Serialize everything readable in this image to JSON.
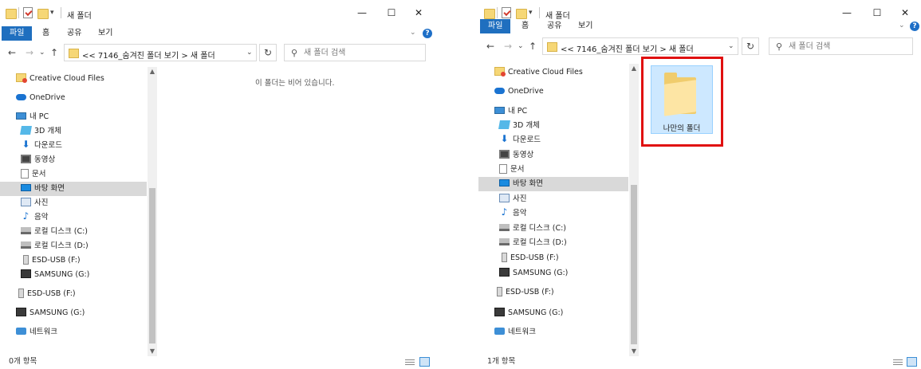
{
  "left": {
    "title": "새 폴더",
    "tabs": [
      "파일",
      "홈",
      "공유",
      "보기"
    ],
    "address": "<<  7146_숨겨진 폴더 보기  >  새 폴더",
    "search_placeholder": "새 폴더 검색",
    "nav": [
      "Creative Cloud Files",
      "OneDrive",
      "내 PC",
      "3D 개체",
      "다운로드",
      "동영상",
      "문서",
      "바탕 화면",
      "사진",
      "음악",
      "로컬 디스크 (C:)",
      "로컬 디스크 (D:)",
      "ESD-USB (F:)",
      "SAMSUNG (G:)",
      "ESD-USB (F:)",
      "SAMSUNG (G:)",
      "네트워크"
    ],
    "empty_message": "이 폴더는 비어 있습니다.",
    "status": "0개 항목"
  },
  "right": {
    "title": "새 폴더",
    "tabs": [
      "파일",
      "홈",
      "공유",
      "보기"
    ],
    "address": "<<  7146_숨겨진 폴더 보기  >  새 폴더",
    "search_placeholder": "새 폴더 검색",
    "nav": [
      "Creative Cloud Files",
      "OneDrive",
      "내 PC",
      "3D 개체",
      "다운로드",
      "동영상",
      "문서",
      "바탕 화면",
      "사진",
      "음악",
      "로컬 디스크 (C:)",
      "로컬 디스크 (D:)",
      "ESD-USB (F:)",
      "SAMSUNG (G:)",
      "ESD-USB (F:)",
      "SAMSUNG (G:)",
      "네트워크"
    ],
    "folder_item": "나만의 폴더",
    "status": "1개 항목"
  },
  "window_controls": {
    "minimize": "—",
    "maximize": "☐",
    "close": "✕"
  },
  "icons": [
    "folder-icon",
    "properties-icon",
    "new-folder-icon",
    "back-arrow-icon",
    "forward-arrow-icon",
    "up-arrow-icon",
    "refresh-icon",
    "search-icon",
    "help-icon"
  ],
  "colors": {
    "file_tab": "#1f6fbf",
    "selection": "#cde8ff",
    "highlight_box": "#e01010"
  }
}
